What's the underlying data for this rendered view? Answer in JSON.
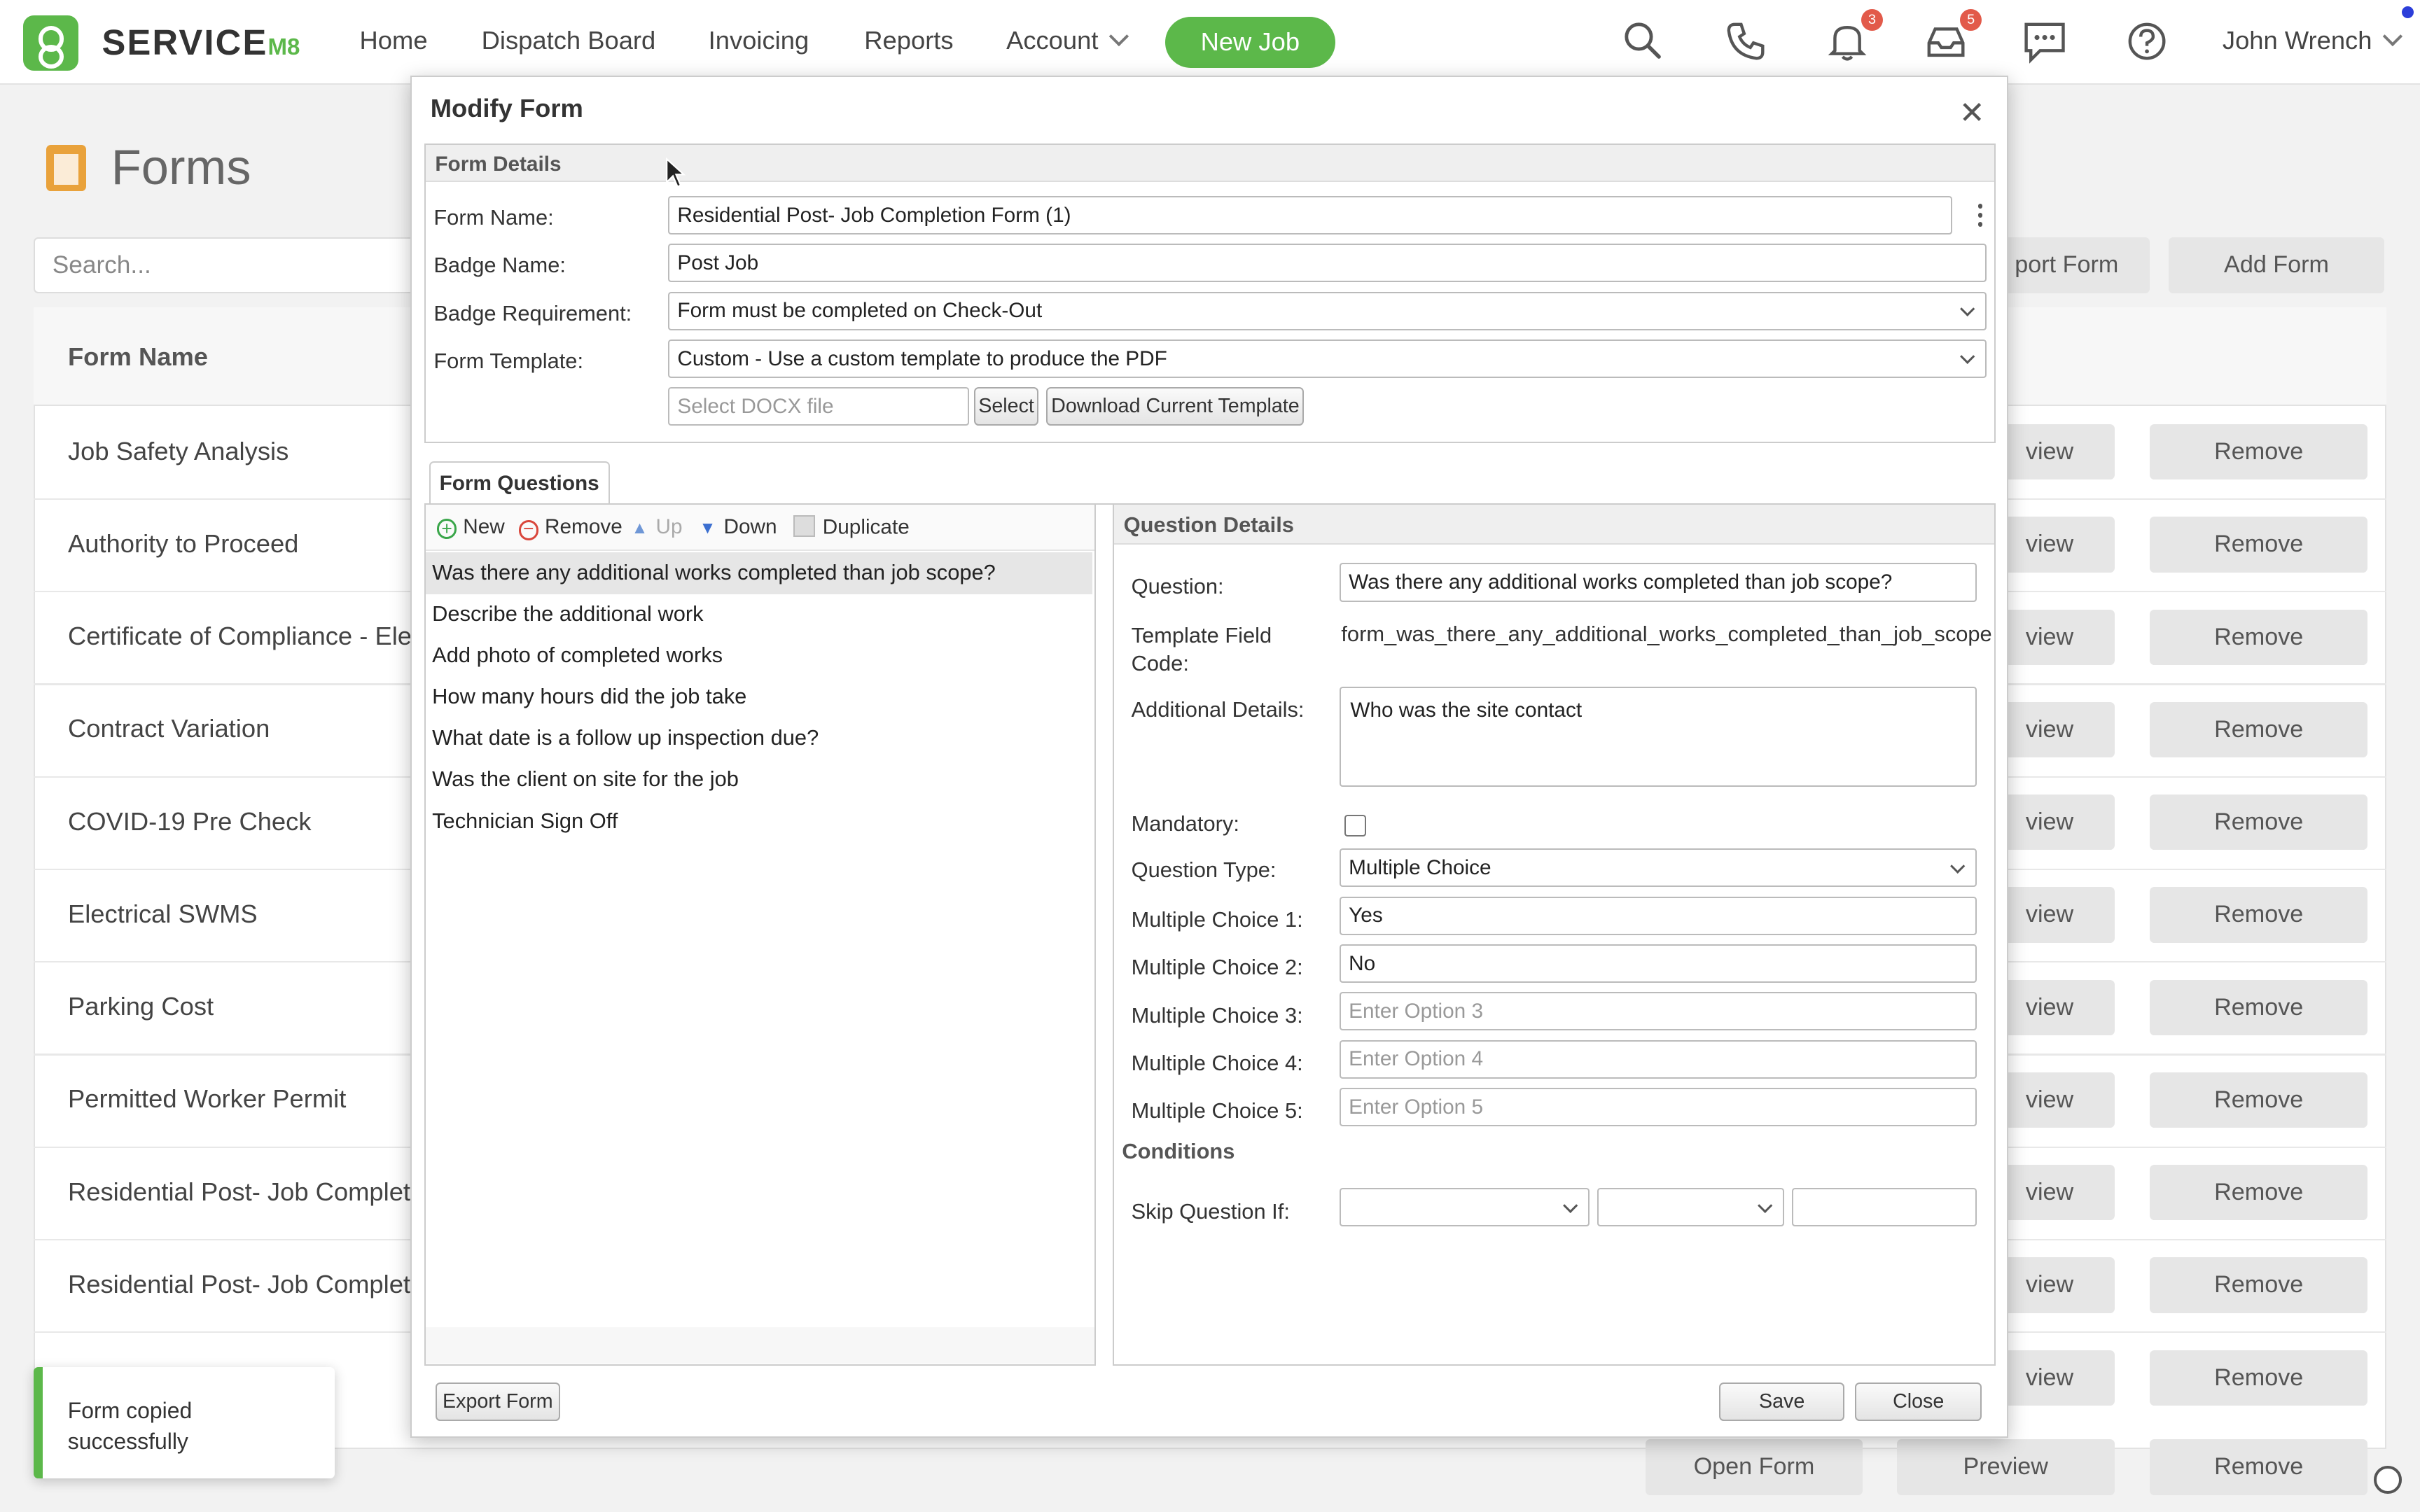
{
  "app": {
    "brand_main": "SERVICE",
    "brand_accent": "M8"
  },
  "nav": {
    "home": "Home",
    "dispatch": "Dispatch Board",
    "invoicing": "Invoicing",
    "reports": "Reports",
    "account": "Account",
    "new_job": "New Job",
    "notif_count": "3",
    "inbox_count": "5",
    "user": "John Wrench"
  },
  "page": {
    "title": "Forms",
    "search_placeholder": "Search...",
    "import_form_partial": "port Form",
    "add_form": "Add Form",
    "column_header": "Form Name",
    "rows": [
      "Job Safety Analysis",
      "Authority to Proceed",
      "Certificate of Compliance - Elect",
      "Contract Variation",
      "COVID-19 Pre Check",
      "Electrical SWMS",
      "Parking Cost",
      "Permitted Worker Permit",
      "Residential Post- Job Completio",
      "Residential Post- Job Completio"
    ],
    "preview_partial": "view",
    "remove": "Remove",
    "open_form": "Open Form",
    "preview": "Preview"
  },
  "toast": {
    "message": "Form copied successfully"
  },
  "dialog": {
    "title": "Modify Form",
    "form_details": {
      "heading": "Form Details",
      "form_name_label": "Form Name:",
      "form_name": "Residential Post- Job Completion Form (1)",
      "badge_name_label": "Badge Name:",
      "badge_name": "Post Job",
      "badge_req_label": "Badge Requirement:",
      "badge_req": "Form must be completed on Check-Out",
      "template_label": "Form Template:",
      "template": "Custom - Use a custom template to produce the PDF",
      "docx_placeholder": "Select DOCX file",
      "select_btn": "Select",
      "download_btn": "Download Current Template"
    },
    "questions_tab": "Form Questions",
    "toolbar": {
      "new": "New",
      "remove": "Remove",
      "up": "Up",
      "down": "Down",
      "duplicate": "Duplicate"
    },
    "questions": [
      "Was there any additional works completed than job scope?",
      "Describe the additional work",
      "Add photo of completed works",
      "How many hours did the job take",
      "What date is a follow up inspection due?",
      "Was the client on site for the job",
      "Technician Sign Off"
    ],
    "details": {
      "heading": "Question Details",
      "question_label": "Question:",
      "question": "Was there any additional works completed than job scope?",
      "field_code_label": "Template Field Code:",
      "field_code": "form_was_there_any_additional_works_completed_than_job_scope",
      "additional_label": "Additional Details:",
      "additional": "Who was the site contact",
      "mandatory_label": "Mandatory:",
      "mandatory": false,
      "type_label": "Question Type:",
      "type": "Multiple Choice",
      "mc1_label": "Multiple Choice 1:",
      "mc1": "Yes",
      "mc2_label": "Multiple Choice 2:",
      "mc2": "No",
      "mc3_label": "Multiple Choice 3:",
      "mc3_ph": "Enter Option 3",
      "mc4_label": "Multiple Choice 4:",
      "mc4_ph": "Enter Option 4",
      "mc5_label": "Multiple Choice 5:",
      "mc5_ph": "Enter Option 5",
      "conditions": "Conditions",
      "skip_label": "Skip Question If:"
    },
    "export_btn": "Export Form",
    "save_btn": "Save",
    "close_btn": "Close"
  },
  "colors": {
    "brand_green": "#5cb84a",
    "badge_red": "#e25a4a"
  }
}
